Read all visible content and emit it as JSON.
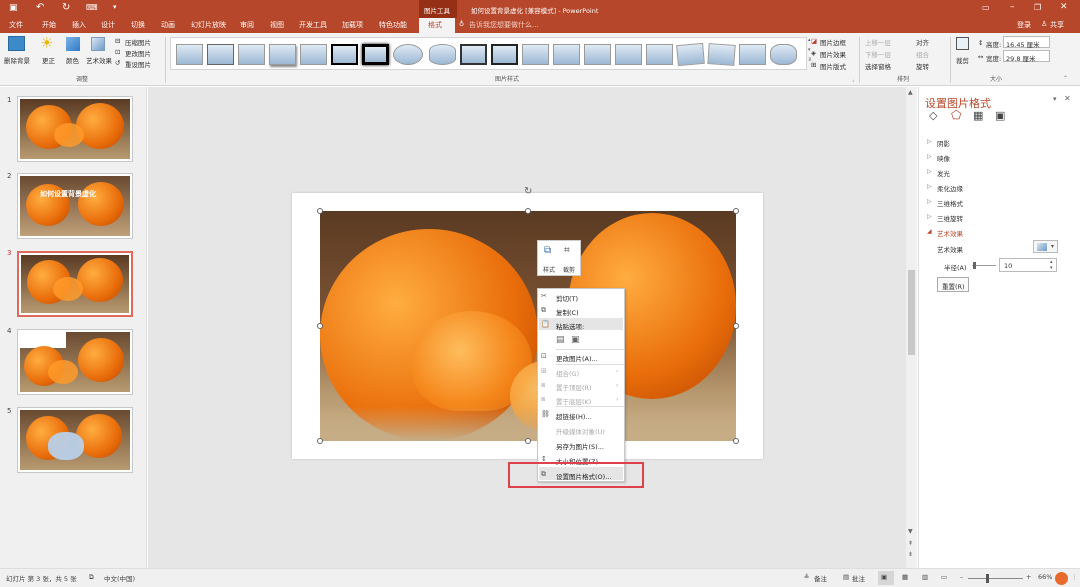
{
  "titlebar": {
    "context_tab": "图片工具",
    "title": "如何设置背景虚化 [兼容模式] - PowerPoint"
  },
  "menubar": {
    "items": [
      "文件",
      "开始",
      "插入",
      "设计",
      "切换",
      "动画",
      "幻灯片放映",
      "审阅",
      "视图",
      "开发工具",
      "加载项",
      "特色功能",
      "格式"
    ],
    "search_placeholder": "告诉我您想要做什么...",
    "login": "登录",
    "share": "共享"
  },
  "ribbon": {
    "adjust": {
      "remove_bg": "删除背景",
      "corrections": "更正",
      "color": "颜色",
      "artistic": "艺术效果",
      "compress": "压缩图片",
      "change": "更改图片",
      "reset": "重设图片",
      "group": "调整"
    },
    "styles_group": "图片样式",
    "style_opts": [
      "图片边框",
      "图片效果",
      "图片版式"
    ],
    "arrange": {
      "forward": "上移一层",
      "backward": "下移一层",
      "pane": "选择窗格",
      "align": "对齐",
      "group_btn": "组合",
      "rotate": "旋转",
      "group": "排列"
    },
    "size": {
      "crop": "裁剪",
      "height_label": "高度:",
      "height": "16.45 厘米",
      "width_label": "宽度:",
      "width": "29.8 厘米",
      "group": "大小"
    }
  },
  "thumbs": {
    "numbers": [
      "1",
      "2",
      "3",
      "4",
      "5"
    ],
    "slide2_title": "如何设置背景虚化"
  },
  "minibar": {
    "style": "样式",
    "crop": "裁剪"
  },
  "context_menu": [
    "剪切(T)",
    "复制(C)",
    "粘贴选项:",
    "更改图片(A)...",
    "组合(G)",
    "置于顶层(R)",
    "置于底层(K)",
    "超链接(H)...",
    "升级媒体对象(U)",
    "另存为图片(S)...",
    "大小和位置(Z)...",
    "设置图片格式(O)..."
  ],
  "pane": {
    "title": "设置图片格式",
    "items": [
      "阴影",
      "映像",
      "发光",
      "柔化边缘",
      "三维格式",
      "三维旋转",
      "艺术效果"
    ],
    "art_effect_label": "艺术效果",
    "radius_label": "半径(A)",
    "radius_value": "10",
    "reset": "重置(R)"
  },
  "status": {
    "slide_info": "幻灯片 第 3 张，共 5 张",
    "language": "中文(中国)",
    "notes": "备注",
    "comments": "批注",
    "zoom": "66%"
  },
  "colors": {
    "accent": "#b7472a",
    "highlight": "#e0404a"
  }
}
